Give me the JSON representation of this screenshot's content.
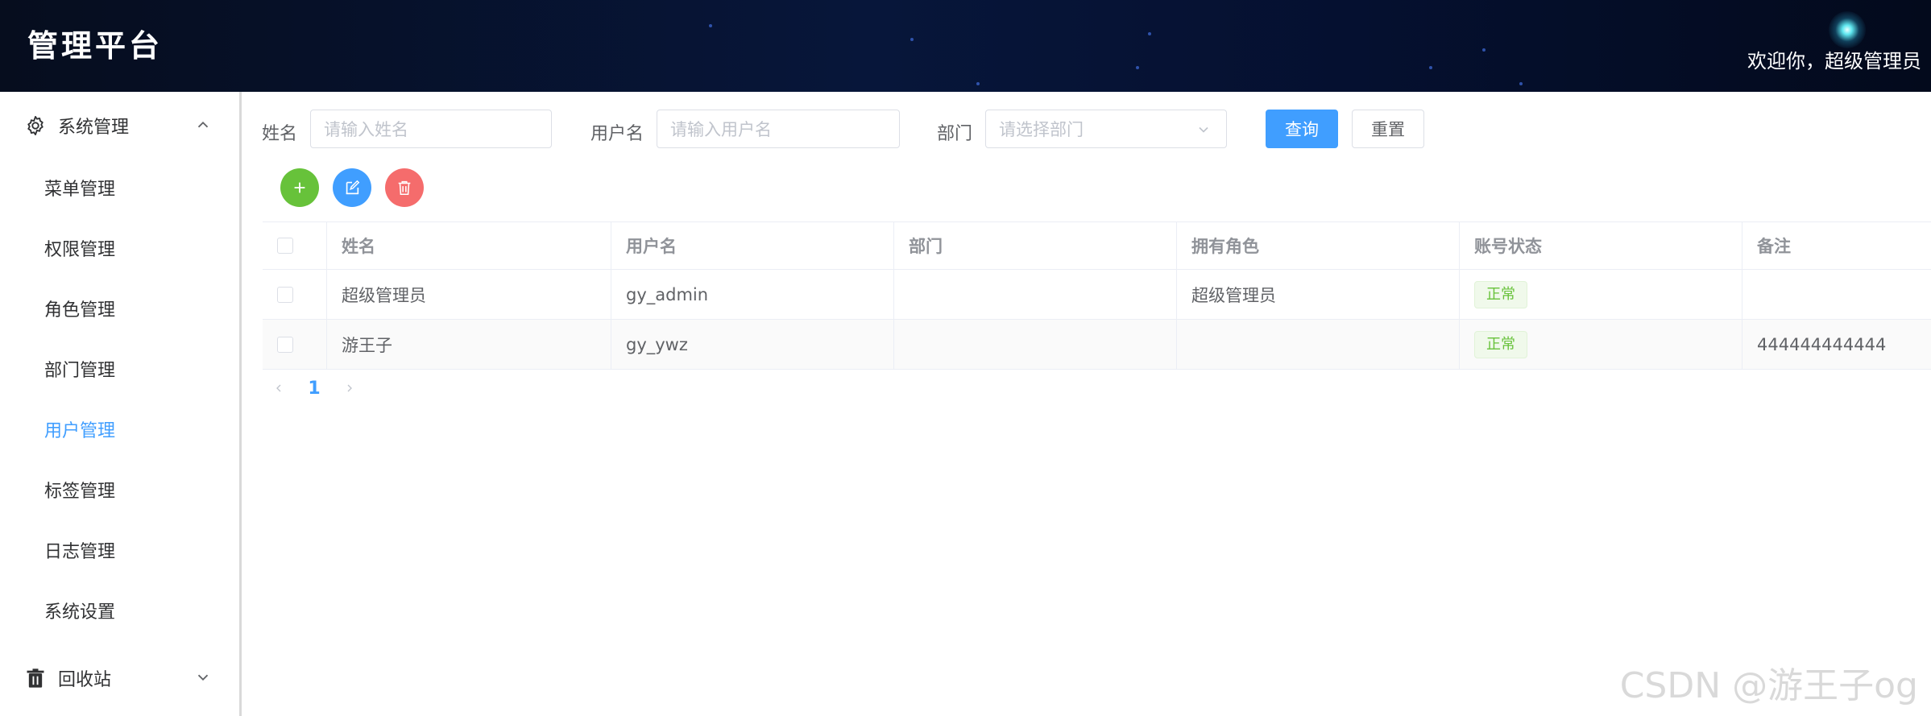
{
  "header": {
    "title": "管理平台",
    "welcome": "欢迎你，超级管理员"
  },
  "sidebar": {
    "group_system": {
      "label": "系统管理",
      "icon": "gear-icon",
      "expanded": true
    },
    "items": [
      {
        "label": "菜单管理",
        "active": false
      },
      {
        "label": "权限管理",
        "active": false
      },
      {
        "label": "角色管理",
        "active": false
      },
      {
        "label": "部门管理",
        "active": false
      },
      {
        "label": "用户管理",
        "active": true
      },
      {
        "label": "标签管理",
        "active": false
      },
      {
        "label": "日志管理",
        "active": false
      },
      {
        "label": "系统设置",
        "active": false
      }
    ],
    "group_recycle": {
      "label": "回收站",
      "icon": "trash-icon",
      "expanded": false
    }
  },
  "filters": {
    "name_label": "姓名",
    "name_placeholder": "请输入姓名",
    "username_label": "用户名",
    "username_placeholder": "请输入用户名",
    "dept_label": "部门",
    "dept_placeholder": "请选择部门",
    "query_button": "查询",
    "reset_button": "重置"
  },
  "toolbar": {
    "add_icon": "plus-icon",
    "edit_icon": "edit-icon",
    "delete_icon": "trash-icon",
    "add_color": "#67c23a",
    "edit_color": "#409eff",
    "delete_color": "#f56c6c"
  },
  "table": {
    "columns": [
      "姓名",
      "用户名",
      "部门",
      "拥有角色",
      "账号状态",
      "备注"
    ],
    "rows": [
      {
        "name": "超级管理员",
        "username": "gy_admin",
        "dept": "",
        "roles": "超级管理员",
        "status": "正常",
        "remark": ""
      },
      {
        "name": "游王子",
        "username": "gy_ywz",
        "dept": "",
        "roles": "",
        "status": "正常",
        "remark": "444444444444"
      }
    ]
  },
  "pagination": {
    "current_page": "1"
  },
  "watermark": "CSDN @游王子og",
  "colors": {
    "primary": "#409eff",
    "success": "#67c23a",
    "danger": "#f56c6c"
  }
}
